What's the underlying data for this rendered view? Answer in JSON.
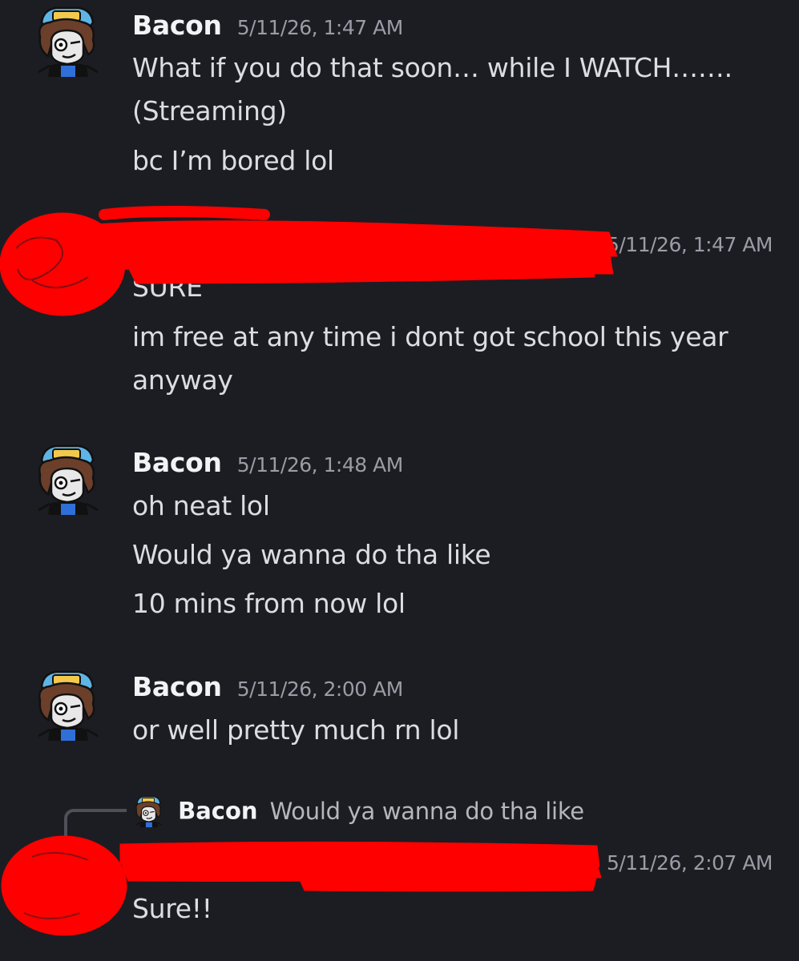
{
  "messages": [
    {
      "author": "Bacon",
      "timestamp": "5/11/26, 1:47 AM",
      "lines": [
        "What if you do that soon… while I WATCH…….",
        "(Streaming)",
        "bc I’m bored lol"
      ]
    },
    {
      "author": "",
      "timestamp": "5/11/26, 1:47 AM",
      "redacted": true,
      "lines": [
        "SURE",
        "im free at any time i dont got school this year",
        "anyway"
      ]
    },
    {
      "author": "Bacon",
      "timestamp": "5/11/26, 1:48 AM",
      "lines": [
        "oh neat lol",
        "Would ya wanna do tha like",
        "10 mins from now lol"
      ]
    },
    {
      "author": "Bacon",
      "timestamp": "5/11/26, 2:00 AM",
      "lines": [
        "or well pretty much rn lol"
      ]
    },
    {
      "author": "",
      "timestamp": "5/11/26, 2:07 AM",
      "redacted": true,
      "reply": {
        "author": "Bacon",
        "text": "Would ya wanna do tha like"
      },
      "lines": [
        "Sure!!"
      ]
    }
  ],
  "colors": {
    "background": "#1c1d22",
    "text": "#dcdde1",
    "username": "#f2f3f5",
    "timestamp": "#9a9ca6",
    "redaction": "#ff0000"
  },
  "icons": {
    "avatar": "bacon-avatar-icon",
    "redaction": "red-scribble"
  }
}
